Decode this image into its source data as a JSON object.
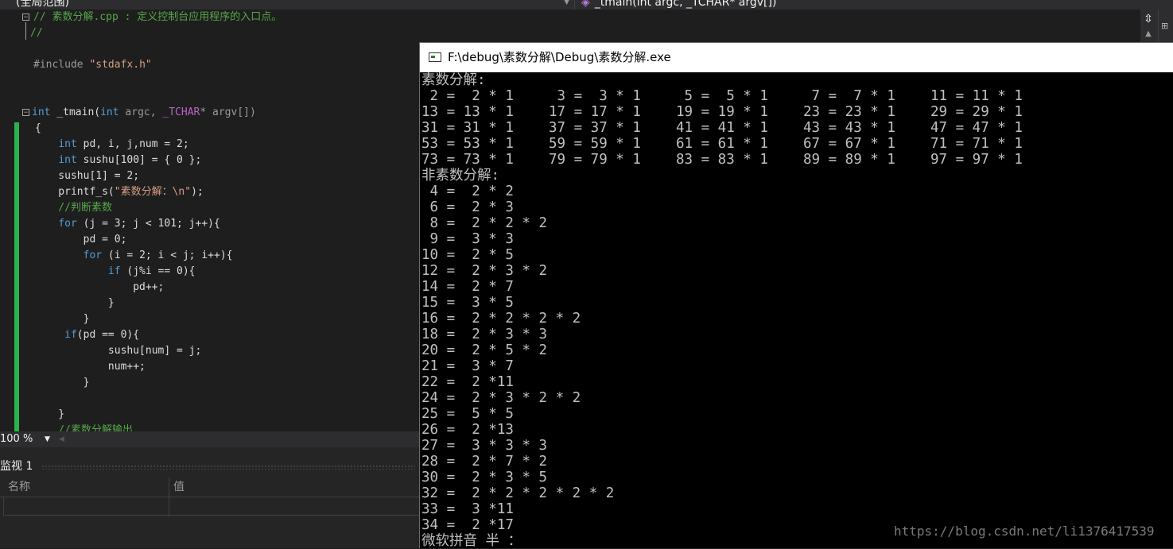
{
  "navbar": {
    "scope": "(全局范围)",
    "function": "_tmain(int argc, _TCHAR* argv[])"
  },
  "editor": {
    "lines": [
      {
        "kind": "comment",
        "text": "// 素数分解.cpp : 定义控制台应用程序的入口点。"
      },
      {
        "kind": "comment",
        "text": "//"
      },
      {
        "kind": "blank",
        "text": ""
      },
      {
        "kind": "include",
        "directive": "#include ",
        "file": "\"stdafx.h\""
      },
      {
        "kind": "blank",
        "text": ""
      },
      {
        "kind": "blank",
        "text": ""
      },
      {
        "kind": "signature",
        "kw": "int",
        "name": " _tmain(",
        "kw2": "int",
        "p1": " argc, ",
        "macro": "_TCHAR",
        "p2": "* argv[])"
      },
      {
        "kind": "plain",
        "text": "{"
      },
      {
        "kind": "decl",
        "kw": "int",
        "rest": " pd, i, j,num = 2;"
      },
      {
        "kind": "decl",
        "kw": "int",
        "rest": " sushu[100] = { 0 };"
      },
      {
        "kind": "plain",
        "text": "    sushu[1] = 2;"
      },
      {
        "kind": "printf",
        "pre": "    printf_s(",
        "str": "\"素数分解：\\n\"",
        "post": ");"
      },
      {
        "kind": "comment",
        "text": "    //判断素数"
      },
      {
        "kind": "for",
        "kw": "for",
        "rest": " (j = 3; j < 101; j++){",
        "indent": "    "
      },
      {
        "kind": "plain",
        "text": "        pd = 0;"
      },
      {
        "kind": "for",
        "kw": "for",
        "rest": " (i = 2; i < j; i++){",
        "indent": "        "
      },
      {
        "kind": "for",
        "kw": "if",
        "rest": " (j%i == 0){",
        "indent": "            "
      },
      {
        "kind": "plain",
        "text": "                pd++;"
      },
      {
        "kind": "plain",
        "text": "            }"
      },
      {
        "kind": "plain",
        "text": "        }"
      },
      {
        "kind": "for",
        "kw": "if",
        "rest": "(pd == 0){",
        "indent": "     "
      },
      {
        "kind": "plain",
        "text": "            sushu[num] = j;"
      },
      {
        "kind": "plain",
        "text": "            num++;"
      },
      {
        "kind": "plain",
        "text": "        }"
      },
      {
        "kind": "blank",
        "text": ""
      },
      {
        "kind": "plain",
        "text": "    }"
      },
      {
        "kind": "comment",
        "text": "    //素数分解输出"
      }
    ]
  },
  "zoom": {
    "value": "100 %"
  },
  "watch": {
    "title": "监视 1",
    "col_name": "名称",
    "col_value": "值"
  },
  "console": {
    "title": "F:\\debug\\素数分解\\Debug\\素数分解.exe",
    "prime_header": "素数分解:",
    "primes": [
      [
        " 2 =  2 * 1",
        " 3 =  3 * 1",
        " 5 =  5 * 1",
        " 7 =  7 * 1",
        "11 = 11 * 1"
      ],
      [
        "13 = 13 * 1",
        "17 = 17 * 1",
        "19 = 19 * 1",
        "23 = 23 * 1",
        "29 = 29 * 1"
      ],
      [
        "31 = 31 * 1",
        "37 = 37 * 1",
        "41 = 41 * 1",
        "43 = 43 * 1",
        "47 = 47 * 1"
      ],
      [
        "53 = 53 * 1",
        "59 = 59 * 1",
        "61 = 61 * 1",
        "67 = 67 * 1",
        "71 = 71 * 1"
      ],
      [
        "73 = 73 * 1",
        "79 = 79 * 1",
        "83 = 83 * 1",
        "89 = 89 * 1",
        "97 = 97 * 1"
      ]
    ],
    "composite_header": "非素数分解:",
    "composites": [
      " 4 =  2 * 2",
      " 6 =  2 * 3",
      " 8 =  2 * 2 * 2",
      " 9 =  3 * 3",
      "10 =  2 * 5",
      "12 =  2 * 3 * 2",
      "14 =  2 * 7",
      "15 =  3 * 5",
      "16 =  2 * 2 * 2 * 2",
      "18 =  2 * 3 * 3",
      "20 =  2 * 5 * 2",
      "21 =  3 * 7",
      "22 =  2 *11",
      "24 =  2 * 3 * 2 * 2",
      "25 =  5 * 5",
      "26 =  2 *13",
      "27 =  3 * 3 * 3",
      "28 =  2 * 7 * 2",
      "30 =  2 * 3 * 5",
      "32 =  2 * 2 * 2 * 2 * 2",
      "33 =  3 *11",
      "34 =  2 *17"
    ],
    "ime_status": "微软拼音 半 ："
  },
  "watermark": "https://blog.csdn.net/li1376417539"
}
